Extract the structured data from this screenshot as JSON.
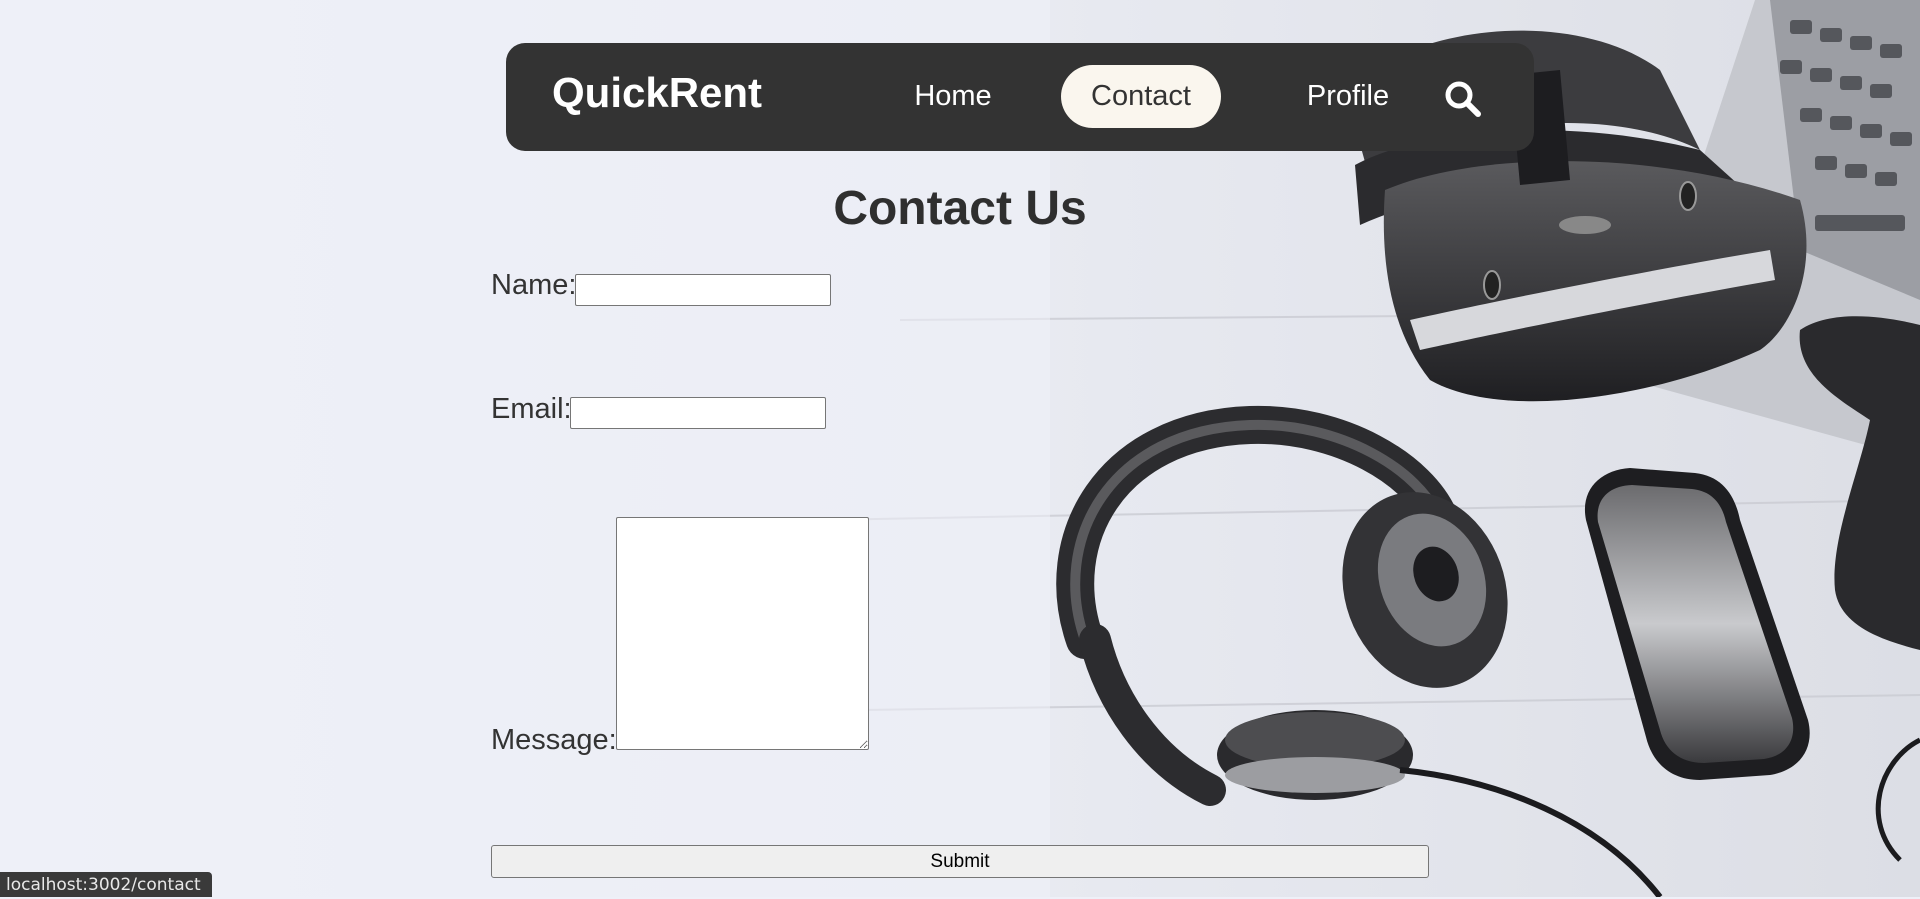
{
  "navbar": {
    "brand": "QuickRent",
    "links": [
      {
        "label": "Home",
        "active": false
      },
      {
        "label": "Contact",
        "active": true
      },
      {
        "label": "Profile",
        "active": false
      }
    ],
    "search_icon": "search-icon"
  },
  "contact_form": {
    "title": "Contact Us",
    "name_label": "Name:",
    "name_value": "",
    "email_label": "Email:",
    "email_value": "",
    "message_label": "Message:",
    "message_value": "",
    "submit_label": "Submit"
  },
  "background": {
    "image": "grayscale photo of VR headset, headphones, smartphone, game controller and laptop on white wooden desk"
  },
  "status_bar": {
    "url": "localhost:3002/contact"
  },
  "colors": {
    "page_background": "#eef0f8",
    "navbar": "#333333",
    "active_pill": "#faf6ee",
    "text": "#333333"
  }
}
